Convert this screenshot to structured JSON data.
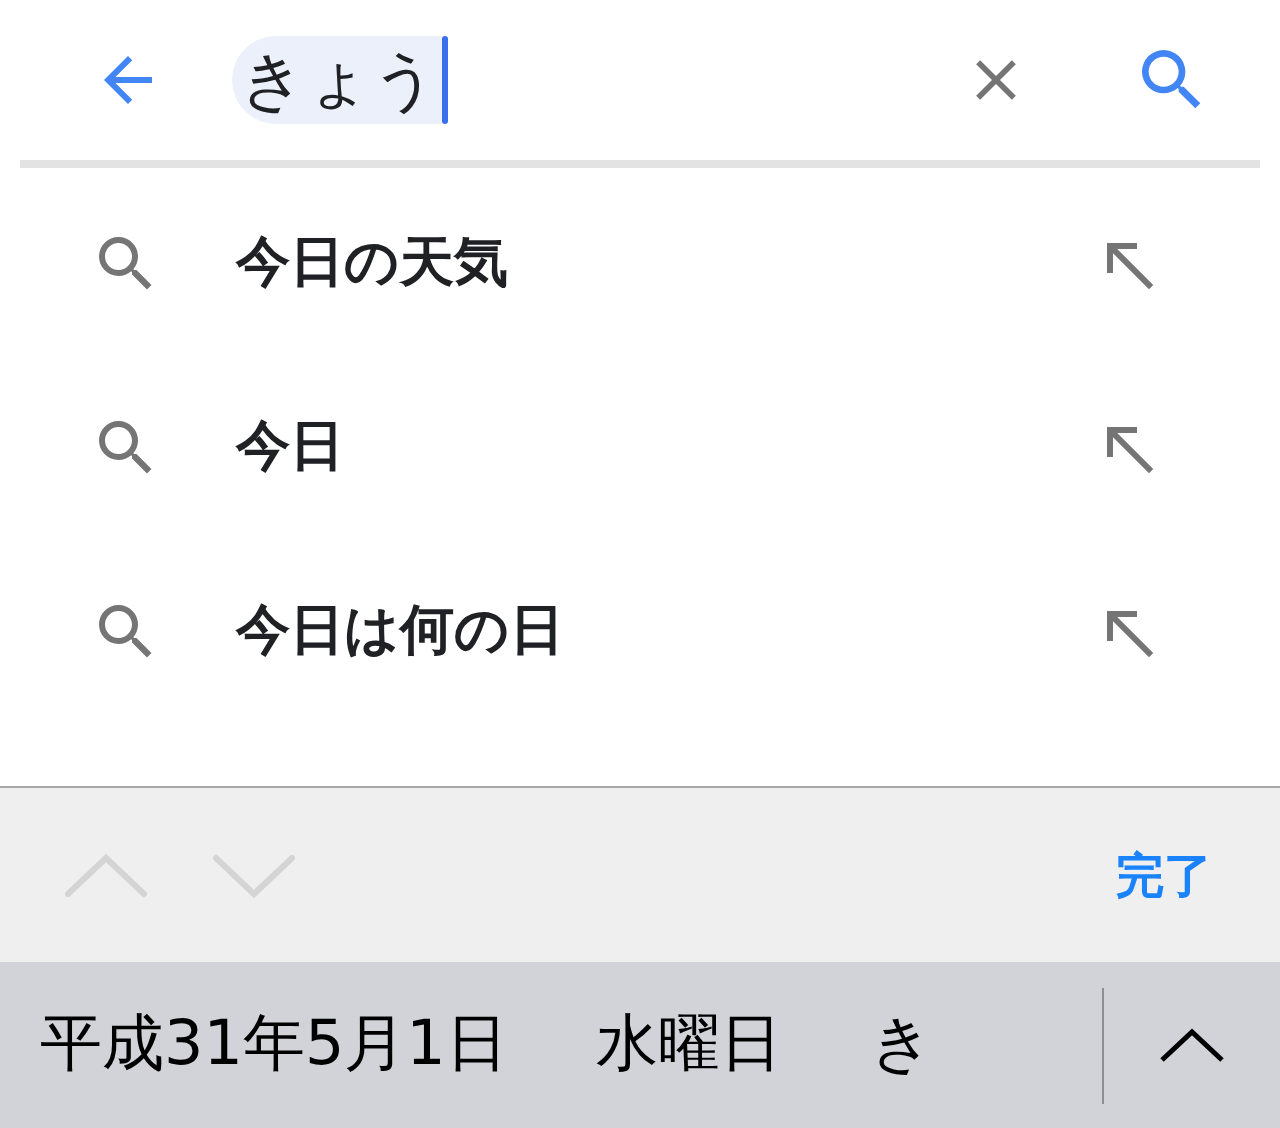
{
  "search": {
    "value": "きょう"
  },
  "suggestions": [
    {
      "text": "今日の天気"
    },
    {
      "text": "今日"
    },
    {
      "text": "今日は何の日"
    }
  ],
  "toolbar": {
    "previous": {
      "disabled": true
    },
    "next": {
      "disabled": true
    },
    "done": "完了"
  },
  "candidates": [
    "平成31年5月1日",
    "水曜日",
    "き"
  ]
}
